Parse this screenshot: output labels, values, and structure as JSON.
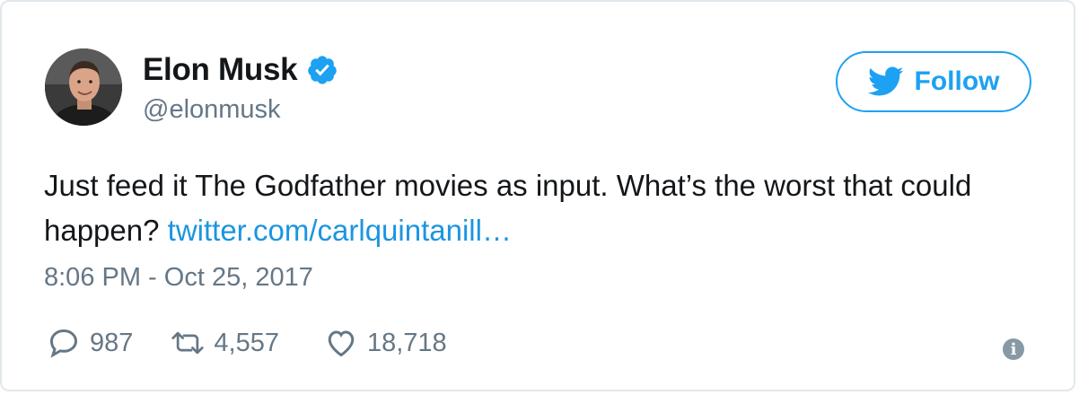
{
  "author": {
    "display_name": "Elon Musk",
    "handle": "@elonmusk",
    "verified": true
  },
  "follow_button": {
    "label": "Follow"
  },
  "tweet": {
    "text": "Just feed it The Godfather movies as input. What’s the worst that could happen?",
    "link": "twitter.com/carlquintanill…",
    "timestamp": "8:06 PM - Oct 25, 2017"
  },
  "actions": {
    "replies": "987",
    "retweets": "4,557",
    "likes": "18,718"
  },
  "colors": {
    "accent": "#1da1f2",
    "link": "#1b95e0",
    "muted": "#657786",
    "border": "#e1e8ed"
  },
  "icons": [
    "verified-badge-icon",
    "twitter-bird-icon",
    "reply-icon",
    "retweet-icon",
    "heart-icon",
    "info-icon"
  ]
}
